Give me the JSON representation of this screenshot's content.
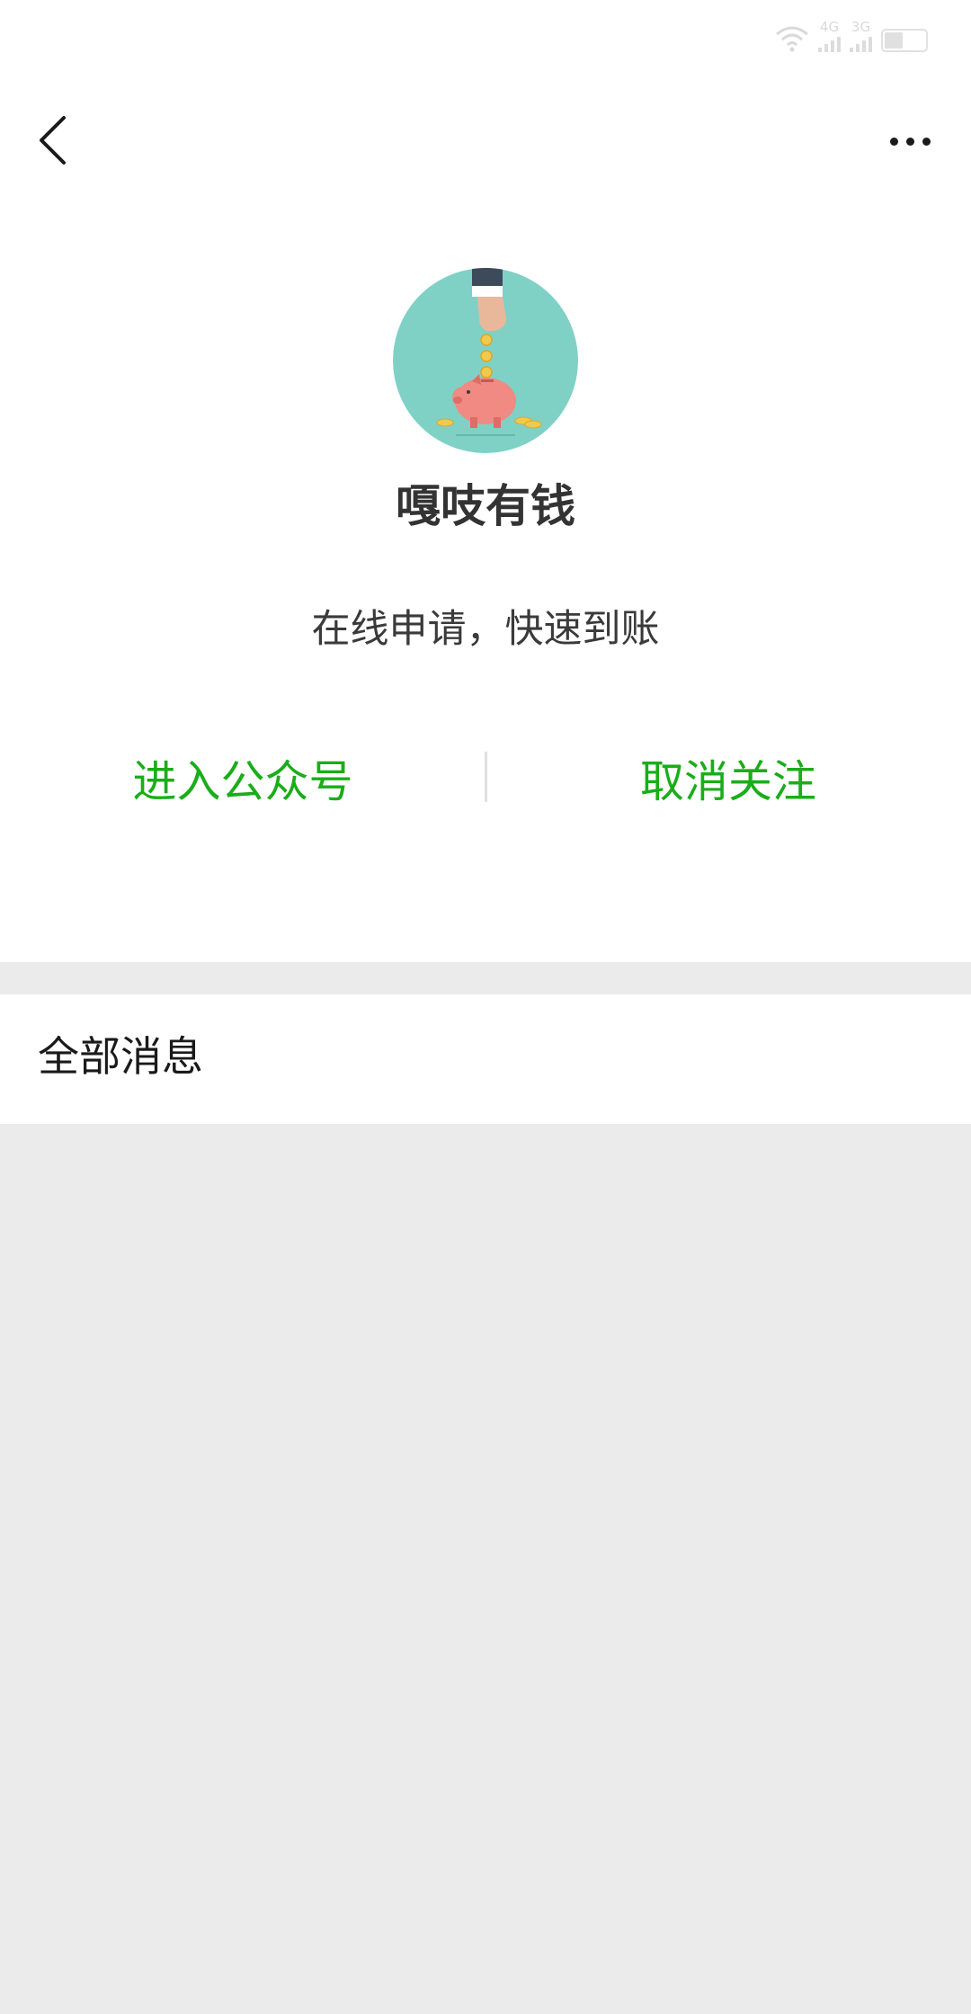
{
  "status_bar": {
    "network_labels": [
      "4G",
      "3G"
    ]
  },
  "header": {
    "back_icon": "chevron-left-icon",
    "more_icon": "more-horizontal-icon"
  },
  "profile": {
    "name": "嘎吱有钱",
    "description": "在线申请，快速到账",
    "avatar_icon": "piggy-bank-avatar",
    "avatar_bg_color": "#7fd1c6"
  },
  "actions": {
    "enter_label": "进入公众号",
    "unfollow_label": "取消关注",
    "accent_color": "#1aad19"
  },
  "messages": {
    "title": "全部消息"
  }
}
